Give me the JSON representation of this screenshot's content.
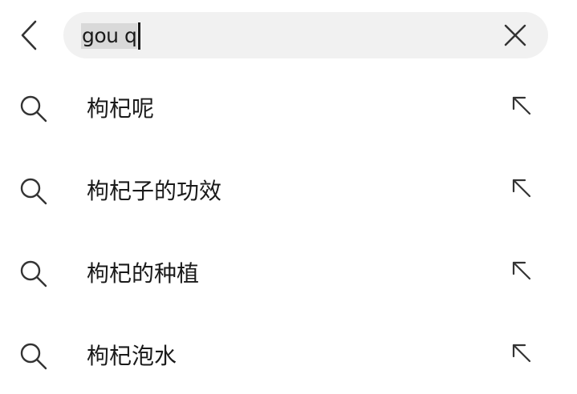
{
  "search": {
    "value_selected": "gou q",
    "icons": {
      "back": "chevron-left-icon",
      "clear": "close-icon"
    }
  },
  "suggestions": [
    {
      "label": "枸杞呢"
    },
    {
      "label": "枸杞子的功效"
    },
    {
      "label": "枸杞的种植"
    },
    {
      "label": "枸杞泡水"
    }
  ],
  "colors": {
    "text": "#1a1a1a",
    "search_bg": "#f1f1f1",
    "selection_bg": "#d9d9d9",
    "icon": "#333333"
  }
}
